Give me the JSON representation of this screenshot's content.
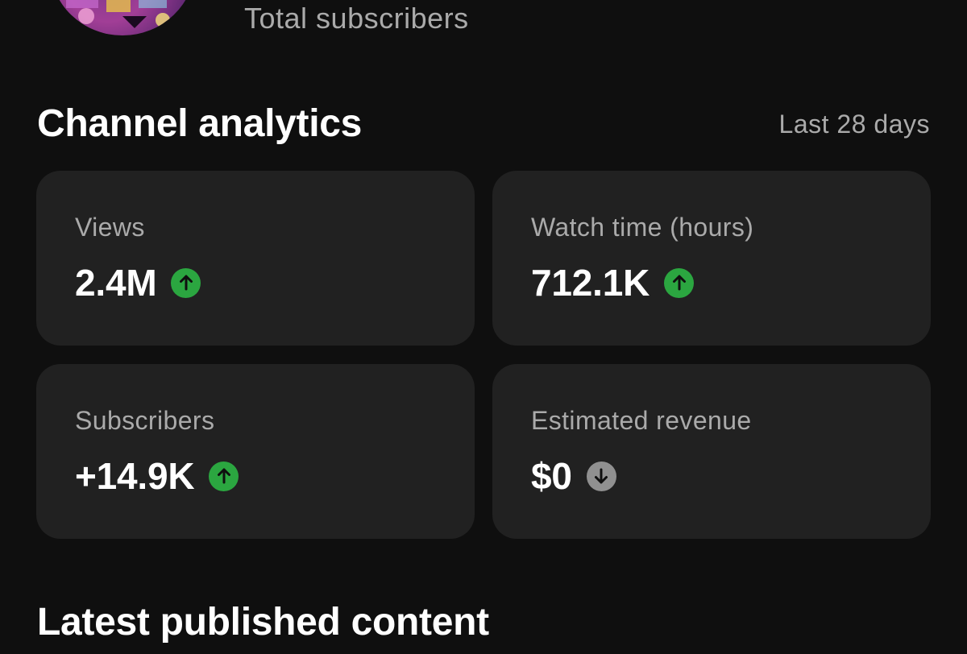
{
  "header": {
    "subscribers_caption": "Total subscribers"
  },
  "analytics": {
    "title": "Channel analytics",
    "period": "Last 28 days",
    "cards": [
      {
        "label": "Views",
        "value": "2.4M",
        "trend": "up",
        "trend_icon": "arrow-up-icon",
        "trend_color": "#2ba640"
      },
      {
        "label": "Watch time (hours)",
        "value": "712.1K",
        "trend": "up",
        "trend_icon": "arrow-up-icon",
        "trend_color": "#2ba640"
      },
      {
        "label": "Subscribers",
        "value": "+14.9K",
        "trend": "up",
        "trend_icon": "arrow-up-icon",
        "trend_color": "#2ba640"
      },
      {
        "label": "Estimated revenue",
        "value": "$0",
        "trend": "down",
        "trend_icon": "arrow-down-icon",
        "trend_color": "#909090"
      }
    ]
  },
  "latest": {
    "title": "Latest published content"
  },
  "colors": {
    "background": "#0f0f0f",
    "card": "#212121",
    "secondary_text": "#aaaaaa"
  }
}
